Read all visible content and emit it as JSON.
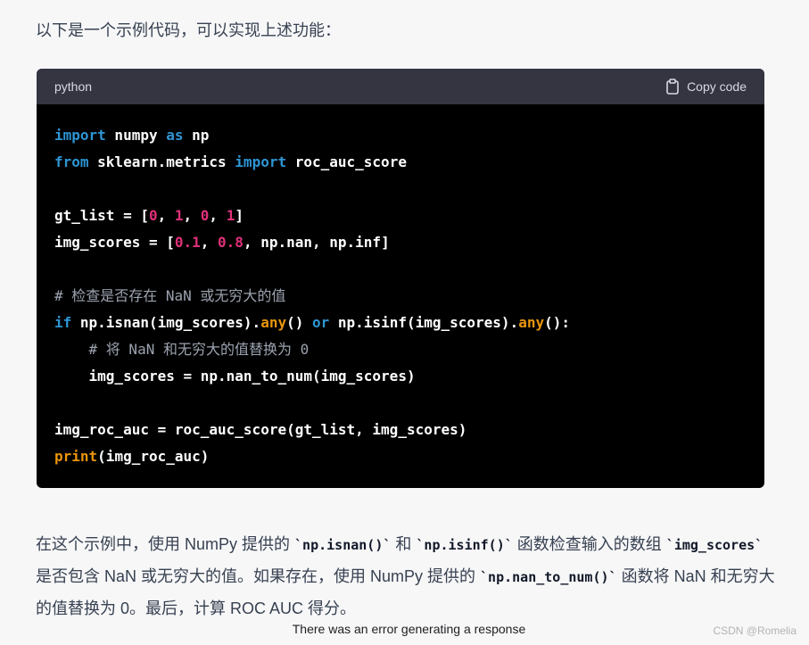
{
  "intro_text": "以下是一个示例代码，可以实现上述功能：",
  "code_block": {
    "language": "python",
    "copy_label": "Copy code",
    "lines": [
      [
        {
          "t": "import",
          "c": "kw"
        },
        {
          "t": " numpy ",
          "c": ""
        },
        {
          "t": "as",
          "c": "kw"
        },
        {
          "t": " np",
          "c": ""
        }
      ],
      [
        {
          "t": "from",
          "c": "kw"
        },
        {
          "t": " sklearn.metrics ",
          "c": ""
        },
        {
          "t": "import",
          "c": "kw"
        },
        {
          "t": " roc_auc_score",
          "c": ""
        }
      ],
      [],
      [
        {
          "t": "gt_list = [",
          "c": ""
        },
        {
          "t": "0",
          "c": "num"
        },
        {
          "t": ", ",
          "c": ""
        },
        {
          "t": "1",
          "c": "num"
        },
        {
          "t": ", ",
          "c": ""
        },
        {
          "t": "0",
          "c": "num"
        },
        {
          "t": ", ",
          "c": ""
        },
        {
          "t": "1",
          "c": "num"
        },
        {
          "t": "]",
          "c": ""
        }
      ],
      [
        {
          "t": "img_scores = [",
          "c": ""
        },
        {
          "t": "0.1",
          "c": "num"
        },
        {
          "t": ", ",
          "c": ""
        },
        {
          "t": "0.8",
          "c": "num"
        },
        {
          "t": ", np.nan, np.inf]",
          "c": ""
        }
      ],
      [],
      [
        {
          "t": "# 检查是否存在 NaN 或无穷大的值",
          "c": "cm"
        }
      ],
      [
        {
          "t": "if",
          "c": "kw"
        },
        {
          "t": " np.isnan(img_scores).",
          "c": ""
        },
        {
          "t": "any",
          "c": "fn"
        },
        {
          "t": "() ",
          "c": ""
        },
        {
          "t": "or",
          "c": "kw"
        },
        {
          "t": " np.isinf(img_scores).",
          "c": ""
        },
        {
          "t": "any",
          "c": "fn"
        },
        {
          "t": "():",
          "c": ""
        }
      ],
      [
        {
          "t": "    ",
          "c": ""
        },
        {
          "t": "# 将 NaN 和无穷大的值替换为 0",
          "c": "cm"
        }
      ],
      [
        {
          "t": "    img_scores = np.nan_to_num(img_scores)",
          "c": ""
        }
      ],
      [],
      [
        {
          "t": "img_roc_auc = roc_auc_score(gt_list, img_scores)",
          "c": ""
        }
      ],
      [
        {
          "t": "print",
          "c": "fn"
        },
        {
          "t": "(img_roc_auc)",
          "c": ""
        }
      ]
    ]
  },
  "explanation": {
    "parts": [
      {
        "t": "在这个示例中，使用 NumPy 提供的 ",
        "code": false
      },
      {
        "t": "`np.isnan()`",
        "code": true
      },
      {
        "t": " 和 ",
        "code": false
      },
      {
        "t": "`np.isinf()`",
        "code": true
      },
      {
        "t": " 函数检查输入的数组 ",
        "code": false
      },
      {
        "t": "`img_scores`",
        "code": true
      },
      {
        "t": " 是否包含 NaN 或无穷大的值。如果存在，使用 NumPy 提供的 ",
        "code": false
      },
      {
        "t": "`np.nan_to_num()`",
        "code": true
      },
      {
        "t": " 函数将 NaN 和无穷大的值替换为 0。最后，计算 ROC AUC 得分。",
        "code": false
      }
    ]
  },
  "error_message": "There was an error generating a response",
  "watermark": "CSDN @Romelia",
  "colors": {
    "background": "#f7f7f8",
    "code_bg": "#000000",
    "code_header_bg": "#343541",
    "keyword": "#2e95d3",
    "number": "#df3079",
    "builtin": "#e9950c",
    "comment": "#9ca3af"
  },
  "icons": {
    "copy": "clipboard-icon"
  }
}
